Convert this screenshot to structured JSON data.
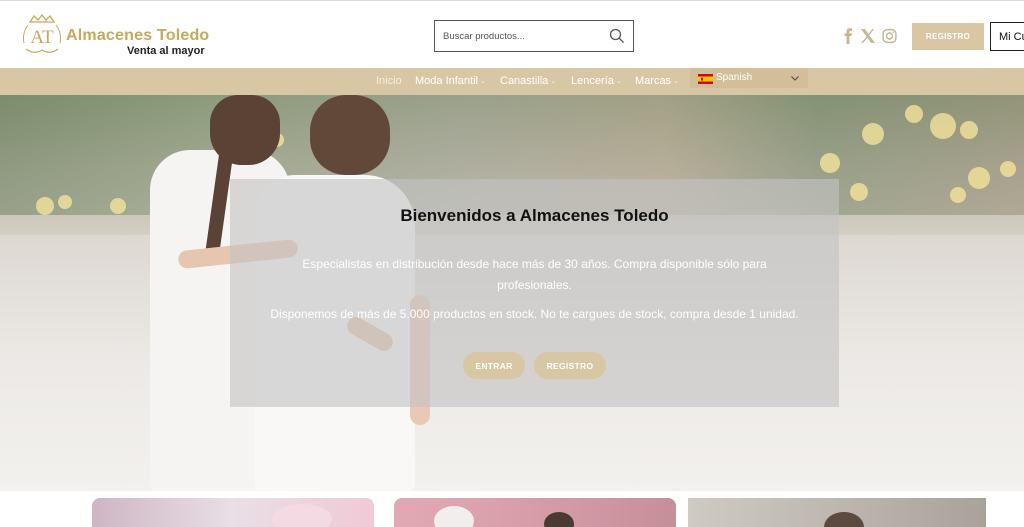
{
  "header": {
    "logo_monogram": "AT",
    "logo_title": "Almacenes Toledo",
    "logo_subtitle": "Venta al mayor",
    "search_placeholder": "Buscar productos...",
    "search_value": "",
    "social": [
      "facebook-icon",
      "x-twitter-icon",
      "instagram-icon"
    ],
    "registro_label": "REGISTRO",
    "cuenta_label": "Mi Cuenta"
  },
  "nav": {
    "items": [
      {
        "label": "Inicio",
        "has_dropdown": false
      },
      {
        "label": "Moda Infantil",
        "has_dropdown": true
      },
      {
        "label": "Canastilla",
        "has_dropdown": true
      },
      {
        "label": "Lencería",
        "has_dropdown": true
      },
      {
        "label": "Marcas",
        "has_dropdown": true
      }
    ],
    "language": {
      "flag": "spain-flag",
      "label": "Spanish"
    }
  },
  "hero": {
    "title": "Bienvenidos a Almacenes Toledo",
    "paragraph1": "Especialistas en distribución desde hace más de 30 años. Compra disponible sólo para profesionales.",
    "paragraph2": "Disponemos de más de 5.000 productos en stock. No te cargues de stock, compra desde 1 unidad.",
    "btn_entrar": "ENTRAR",
    "btn_registro": "REGISTRO"
  },
  "colors": {
    "accent": "#d8c7a3",
    "logo_gold": "#c9a85a",
    "nav_bg": "#d8c7a4"
  }
}
